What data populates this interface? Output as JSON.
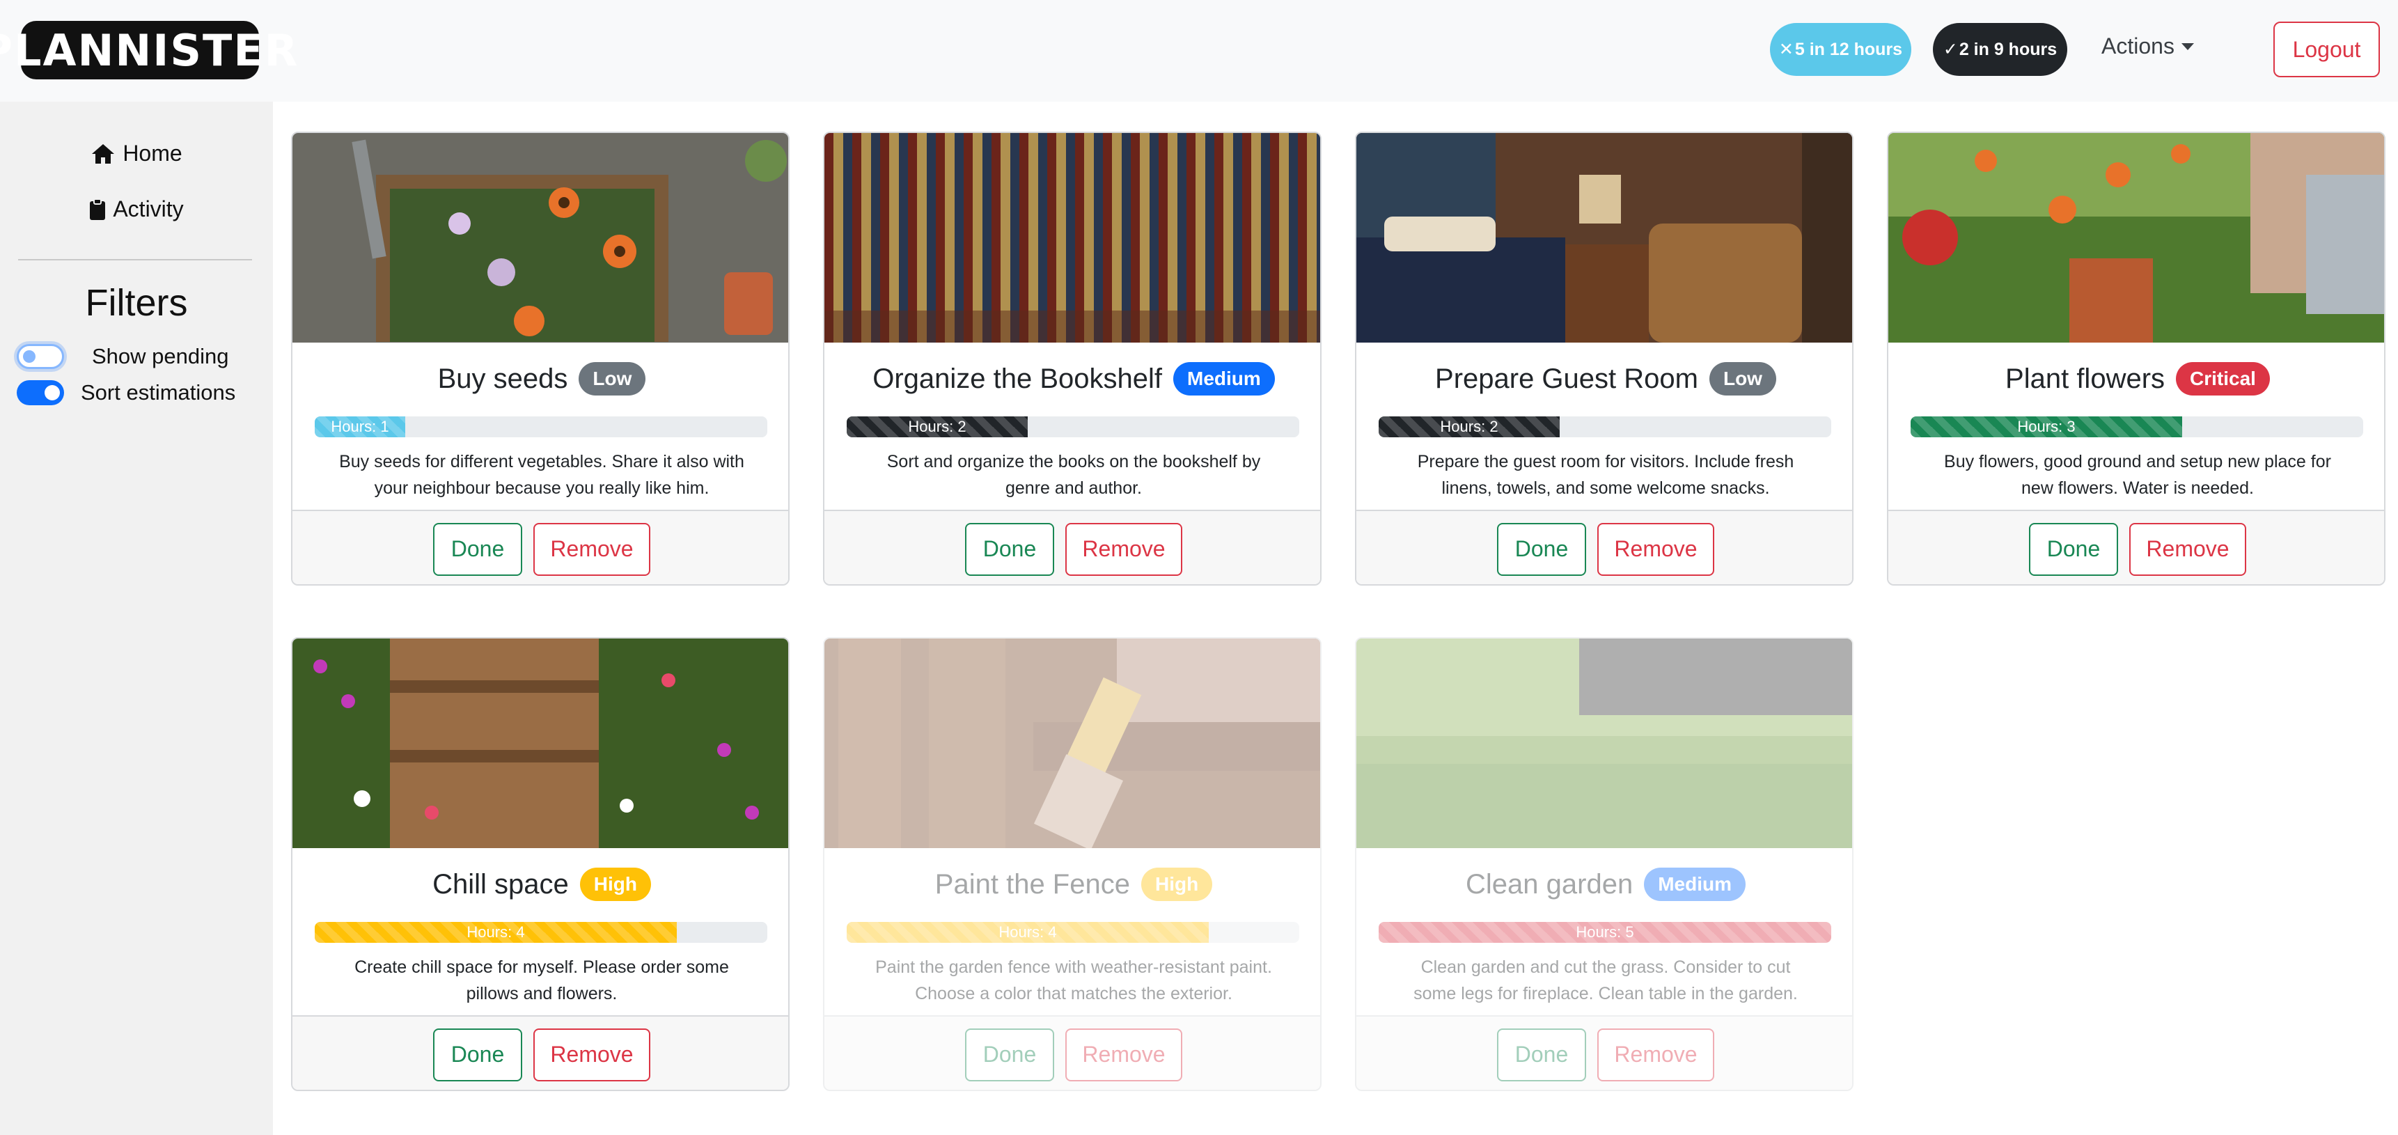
{
  "header": {
    "logo_text": "PLANNISTER",
    "pending_pill": "5 in 12 hours",
    "done_pill": "2 in 9 hours",
    "actions_label": "Actions",
    "logout_label": "Logout"
  },
  "sidebar": {
    "home_label": "Home",
    "activity_label": "Activity",
    "filters_title": "Filters",
    "show_pending_label": "Show pending",
    "show_pending_on": false,
    "sort_estimations_label": "Sort estimations",
    "sort_estimations_on": true
  },
  "colors": {
    "low": "#6c757d",
    "medium": "#0d6efd",
    "high": "#ffc107",
    "critical": "#dc3545",
    "info": "#5bc8ea",
    "dark": "#212529",
    "success": "#198754"
  },
  "cards": [
    {
      "title": "Buy seeds",
      "priority": "Low",
      "hours_label": "Hours: 1",
      "progress": 0.2,
      "description": "Buy seeds for different vegetables. Share it also with your neighbour because you really like him.",
      "done_label": "Done",
      "remove_label": "Remove"
    },
    {
      "title": "Organize the Bookshelf",
      "priority": "Medium",
      "hours_label": "Hours: 2",
      "progress": 0.4,
      "description": "Sort and organize the books on the bookshelf by genre and author.",
      "done_label": "Done",
      "remove_label": "Remove"
    },
    {
      "title": "Prepare Guest Room",
      "priority": "Low",
      "hours_label": "Hours: 2",
      "progress": 0.4,
      "description": "Prepare the guest room for visitors. Include fresh linens, towels, and some welcome snacks.",
      "done_label": "Done",
      "remove_label": "Remove"
    },
    {
      "title": "Plant flowers",
      "priority": "Critical",
      "hours_label": "Hours: 3",
      "progress": 0.6,
      "description": "Buy flowers, good ground and setup new place for new flowers. Water is needed.",
      "done_label": "Done",
      "remove_label": "Remove"
    },
    {
      "title": "Chill space",
      "priority": "High",
      "hours_label": "Hours: 4",
      "progress": 0.8,
      "description": "Create chill space for myself. Please order some pillows and flowers.",
      "done_label": "Done",
      "remove_label": "Remove"
    },
    {
      "title": "Paint the Fence",
      "priority": "High",
      "hours_label": "Hours: 4",
      "progress": 0.8,
      "description": "Paint the garden fence with weather-resistant paint. Choose a color that matches the exterior.",
      "done_label": "Done",
      "remove_label": "Remove"
    },
    {
      "title": "Clean garden",
      "priority": "Medium",
      "hours_label": "Hours: 5",
      "progress": 1.0,
      "description": "Clean garden and cut the grass. Consider to cut some legs for fireplace. Clean table in the garden.",
      "done_label": "Done",
      "remove_label": "Remove"
    }
  ]
}
